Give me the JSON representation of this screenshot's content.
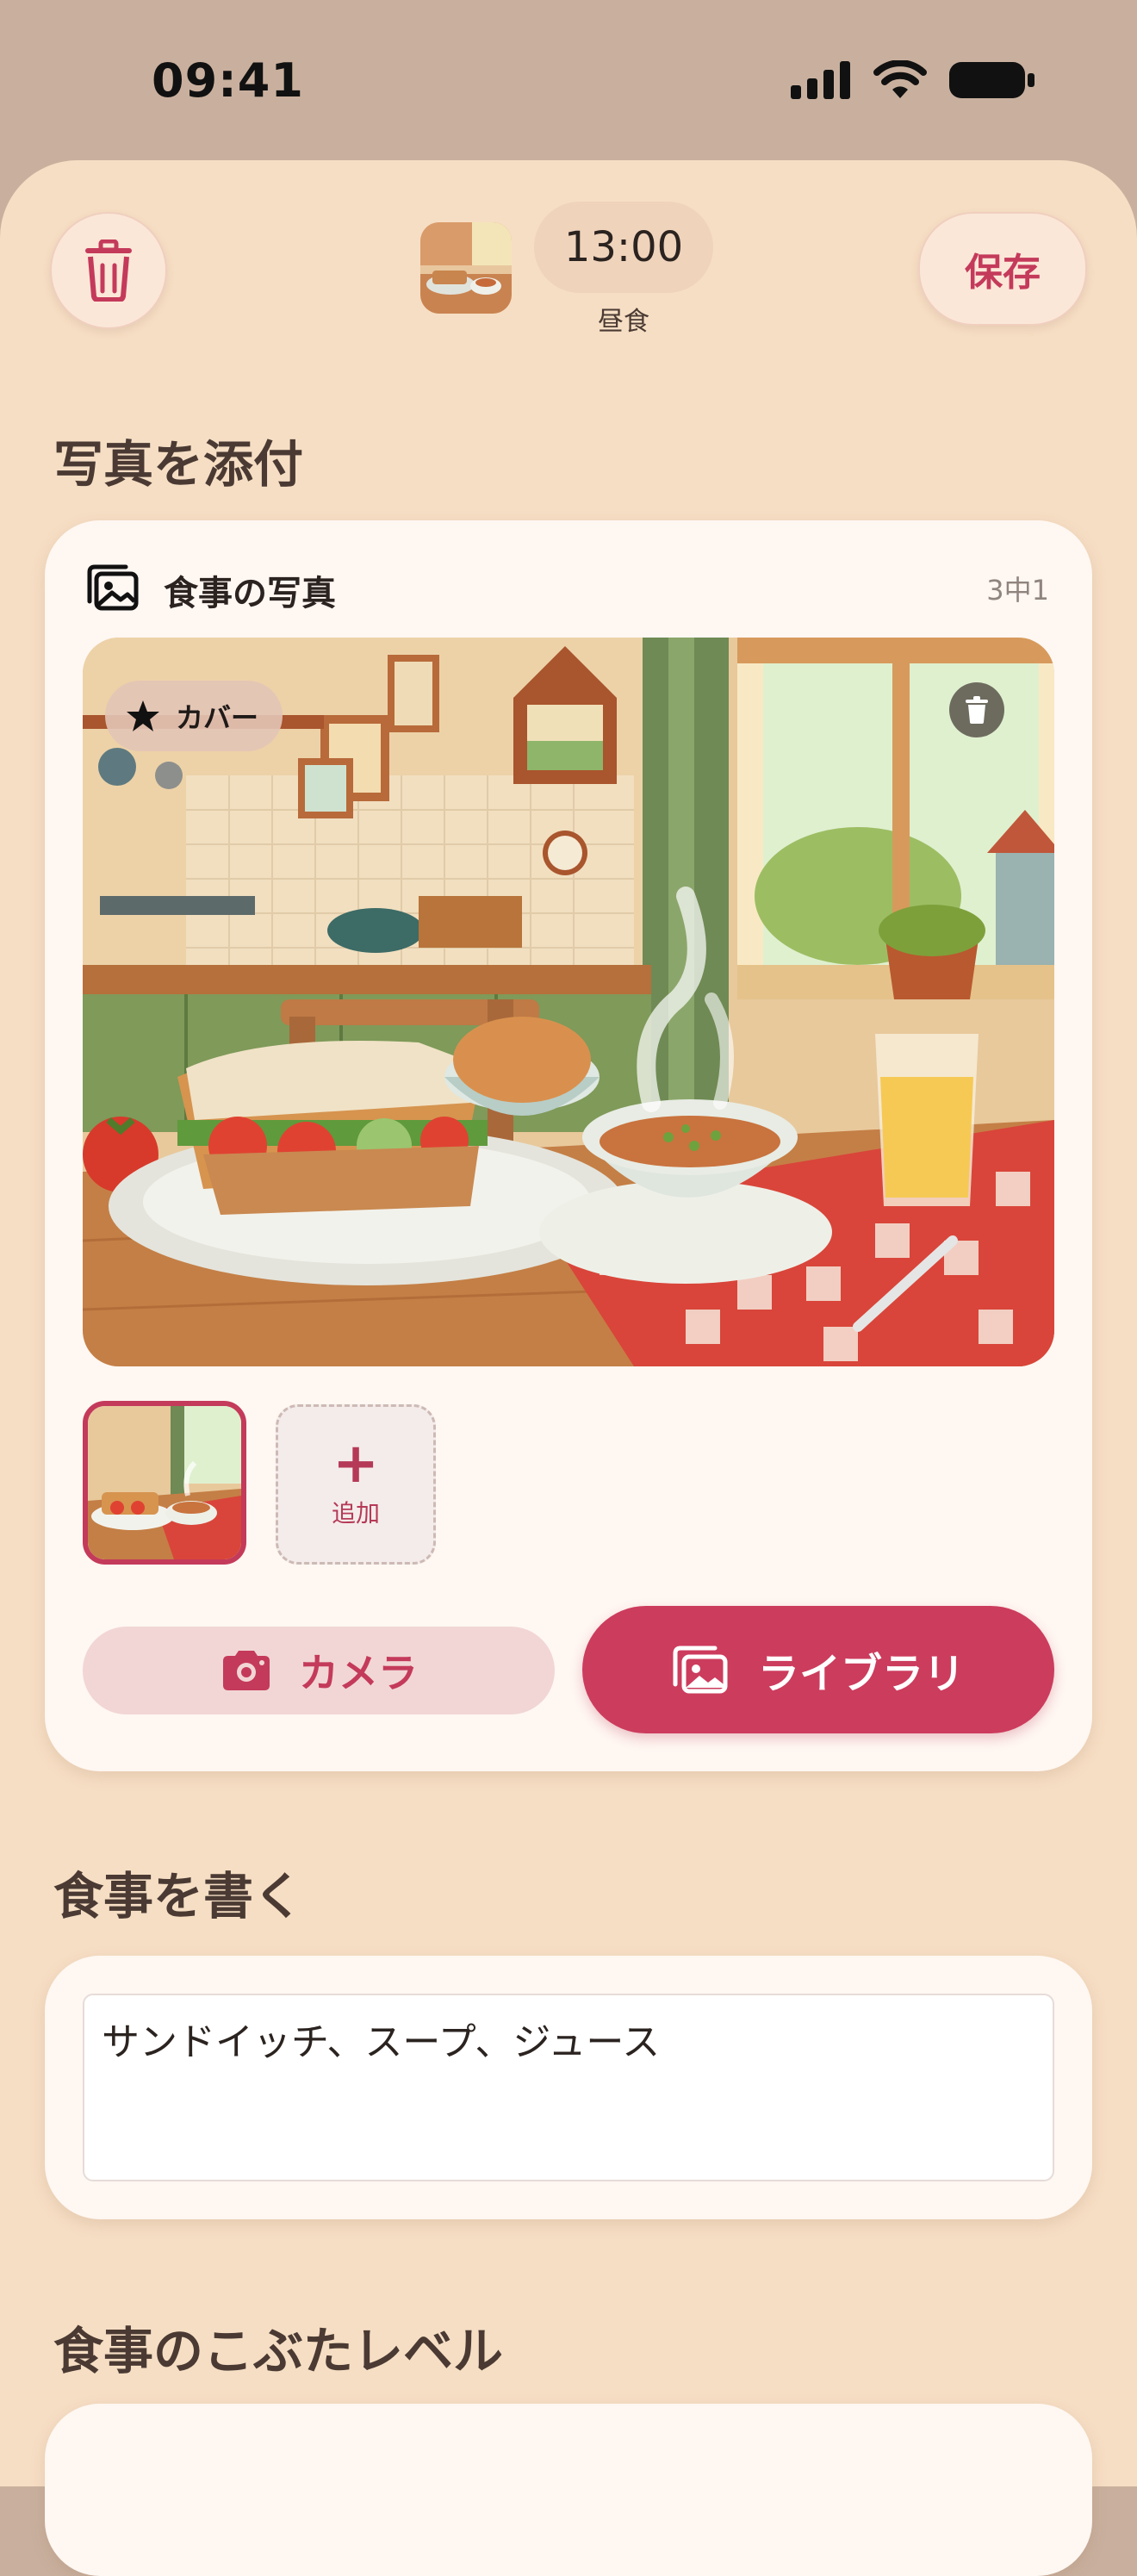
{
  "status_bar": {
    "time": "09:41"
  },
  "header": {
    "meal_time": "13:00",
    "meal_type": "昼食",
    "save_label": "保存"
  },
  "photos": {
    "section_title": "写真を添付",
    "card_title": "食事の写真",
    "count_label": "3中1",
    "cover_label": "カバー",
    "add_label": "追加",
    "camera_label": "カメラ",
    "library_label": "ライブラリ"
  },
  "note": {
    "section_title": "食事を書く",
    "value": "サンドイッチ、スープ、ジュース"
  },
  "fullness": {
    "section_title": "食事のこぶたレベル"
  },
  "colors": {
    "accent": "#cc3c5d",
    "sheet_background": "#f6dec4",
    "card_background": "#fff7f2"
  }
}
